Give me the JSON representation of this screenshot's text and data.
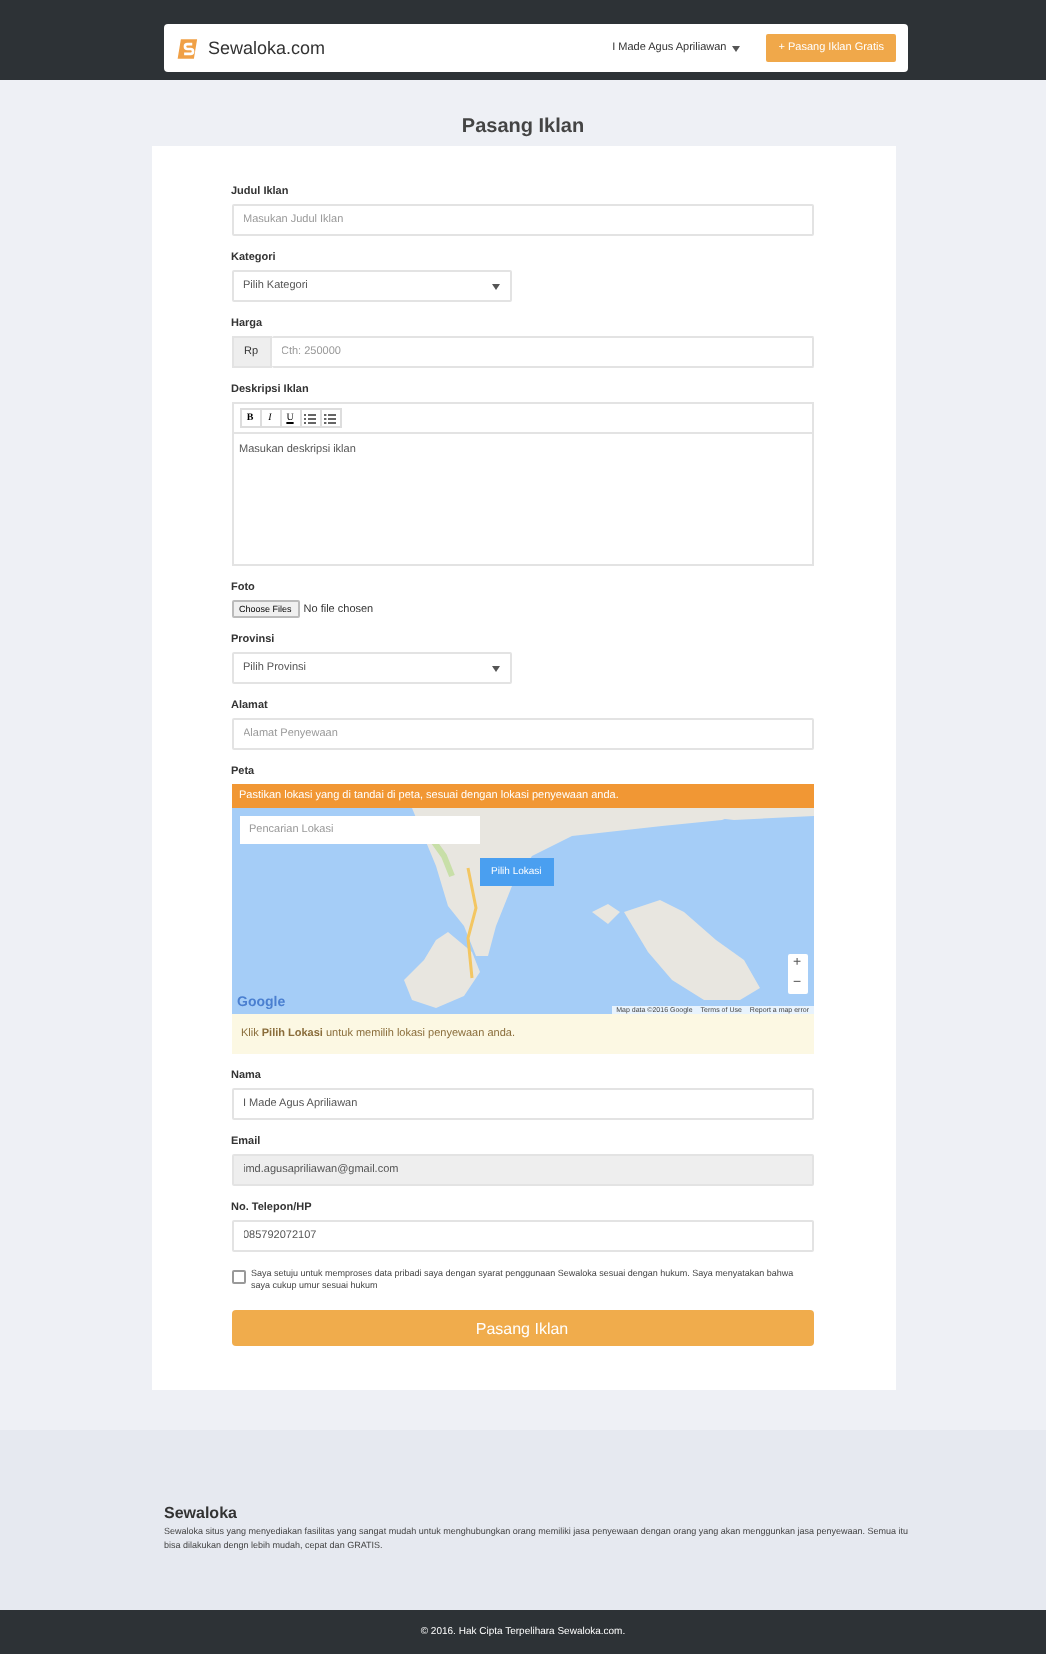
{
  "navbar": {
    "logo": "Sewaloka.com",
    "user_menu": "I Made Agus Apriliawan",
    "post_button": "+ Pasang Iklan Gratis"
  },
  "page_title": "Pasang Iklan",
  "fields": [
    {
      "kind": "text",
      "label": "Judul Iklan",
      "placeholder": "Masukan Judul Iklan",
      "disabled": false
    },
    {
      "kind": "select",
      "label": "Kategori",
      "value": "Pilih Kategori"
    },
    {
      "kind": "price",
      "label": "Harga",
      "prefix": "Rp",
      "placeholder": "Cth: 250000"
    },
    {
      "kind": "editor",
      "label": "Deskripsi Iklan",
      "toolbar": [
        {
          "kind": "bold",
          "label": "B"
        },
        {
          "kind": "italic",
          "label": "I"
        },
        {
          "kind": "underline",
          "label": "U"
        },
        {
          "kind": "bullet_list"
        },
        {
          "kind": "number_list"
        }
      ],
      "placeholder": "Masukan deskripsi iklan"
    },
    {
      "kind": "file",
      "label": "Foto",
      "button": "Choose Files",
      "status": "No file chosen"
    },
    {
      "kind": "select",
      "label": "Provinsi",
      "value": "Pilih Provinsi"
    },
    {
      "kind": "text",
      "label": "Alamat",
      "placeholder": "Alamat Penyewaan",
      "disabled": false
    },
    {
      "kind": "map",
      "label": "Peta",
      "alert": "Pastikan lokasi yang di tandai di peta, sesuai dengan lokasi penyewaan anda.",
      "search_placeholder": "Pencarian Lokasi",
      "pin_button": "Pilih Lokasi",
      "zoom_in": "+",
      "zoom_out": "−",
      "logo": "Google",
      "attribution": [
        "Map data ©2016 Google",
        "Terms of Use",
        "Report a map error"
      ],
      "hint": "Klik **Pilih Lokasi** untuk memilih lokasi penyewaan anda."
    },
    {
      "kind": "text",
      "label": "Nama",
      "value": "I Made Agus Apriliawan",
      "disabled": false
    },
    {
      "kind": "text",
      "label": "Email",
      "value": "imd.agusapriliawan@gmail.com",
      "disabled": true
    },
    {
      "kind": "text",
      "label": "No. Telepon/HP",
      "value": "085792072107",
      "disabled": false
    }
  ],
  "agreement": {
    "checked": false,
    "text": "Saya setuju untuk memproses data pribadi saya dengan syarat penggunaan Sewaloka sesuai dengan hukum. Saya menyatakan bahwa saya cukup umur sesuai hukum"
  },
  "submit": "Pasang Iklan",
  "footer": {
    "title": "Sewaloka",
    "text": "Sewaloka situs yang menyediakan fasilitas yang sangat mudah untuk menghubungkan orang memiliki jasa penyewaan dengan orang yang akan menggunkan jasa penyewaan. Semua itu bisa dilakukan dengn lebih mudah, cepat dan GRATIS."
  },
  "copyright": "© 2016. Hak Cipta Terpelihara Sewaloka.com."
}
